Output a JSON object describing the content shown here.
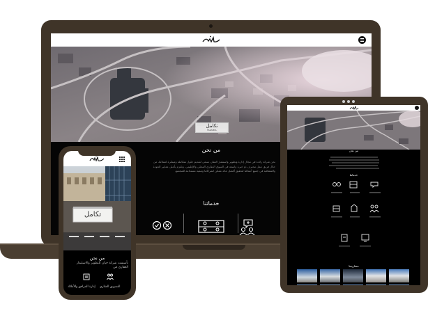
{
  "laptop_site": {
    "badge_title": "تكامل",
    "badge_subtitle": "TAKAMUL",
    "about_title": "من نحن",
    "about_text": "نحن شركة رائدة في مجال إدارة وتطوير واستثمار العقار، نسعى لتقديم حلول متكاملة ومبتكرة لعملائنا، من خلال فريق عمل محترف ذو خبرة واسعة في السوق العقاري المحلي والإقليمي، ونلتزم بأعلى معايير الجودة والشفافية في جميع أعمالنا لتحقيق أفضل عائد ممكن لشركائنا وتنمية مستدامة للمجتمع.",
    "services_title": "خدماتنا"
  },
  "tablet_site": {
    "about_title": "من نحن",
    "services_title": "خدماتنا",
    "projects_title": "مشاريعنا"
  },
  "phone_site": {
    "badge_title": "تكامل",
    "about_title": "من نحن",
    "about_text": "تأسست شركة جيان للتطوير والاستثمار العقاري في",
    "service_1": "إدارة المرافق والأملاك",
    "service_2": "التسويق العقاري"
  },
  "colors": {
    "device_frame": "#3f3428",
    "screen_background": "#050505",
    "header_background": "#ffffff"
  },
  "icons": [
    "logo-icon",
    "menu-icon",
    "check-circle-icon",
    "close-circle-icon",
    "team-board-icon",
    "support-chat-icon",
    "grid-menu-icon",
    "building-doc-icon",
    "people-icon"
  ]
}
